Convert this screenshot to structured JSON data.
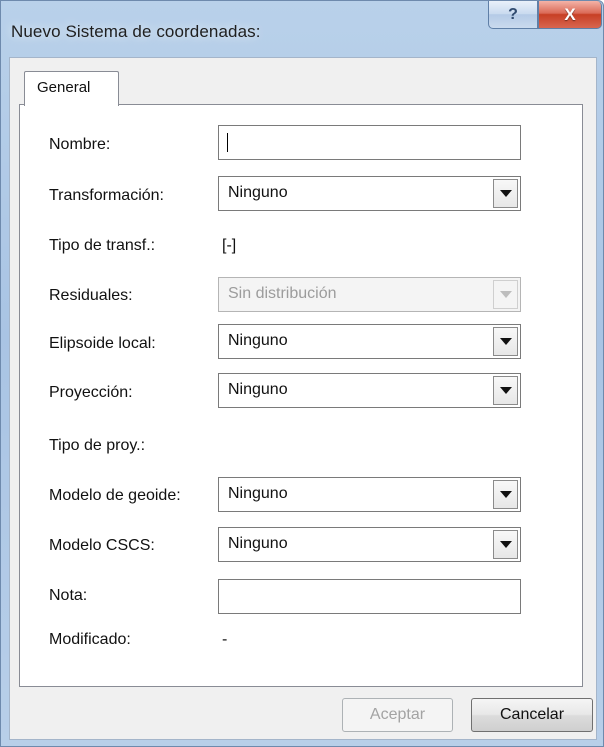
{
  "window": {
    "title": "Nuevo Sistema de coordenadas:",
    "help_label": "?",
    "close_label": "X"
  },
  "tabs": [
    {
      "label": "General"
    }
  ],
  "form": {
    "nombre": {
      "label": "Nombre:",
      "value": ""
    },
    "transformacion": {
      "label": "Transformación:",
      "value": "Ninguno"
    },
    "tipo_transf": {
      "label": "Tipo de transf.:",
      "value": "[-]"
    },
    "residuales": {
      "label": "Residuales:",
      "value": "Sin distribución"
    },
    "elipsoide_local": {
      "label": "Elipsoide local:",
      "value": "Ninguno"
    },
    "proyeccion": {
      "label": "Proyección:",
      "value": "Ninguno"
    },
    "tipo_proy": {
      "label": "Tipo de proy.:",
      "value": ""
    },
    "modelo_geoide": {
      "label": "Modelo de geoide:",
      "value": "Ninguno"
    },
    "modelo_cscs": {
      "label": "Modelo CSCS:",
      "value": "Ninguno"
    },
    "nota": {
      "label": "Nota:",
      "value": ""
    },
    "modificado": {
      "label": "Modificado:",
      "value": "-"
    }
  },
  "buttons": {
    "ok": "Aceptar",
    "cancel": "Cancelar"
  },
  "icons": {
    "help": "question-icon",
    "close": "close-icon",
    "dropdown": "chevron-down-icon"
  },
  "colors": {
    "window_frame": "#b9d1ea",
    "close_button": "#c73f25",
    "dialog_background": "#f0f0f0",
    "tab_panel": "#ffffff",
    "disabled_text": "#9c9c9c"
  }
}
